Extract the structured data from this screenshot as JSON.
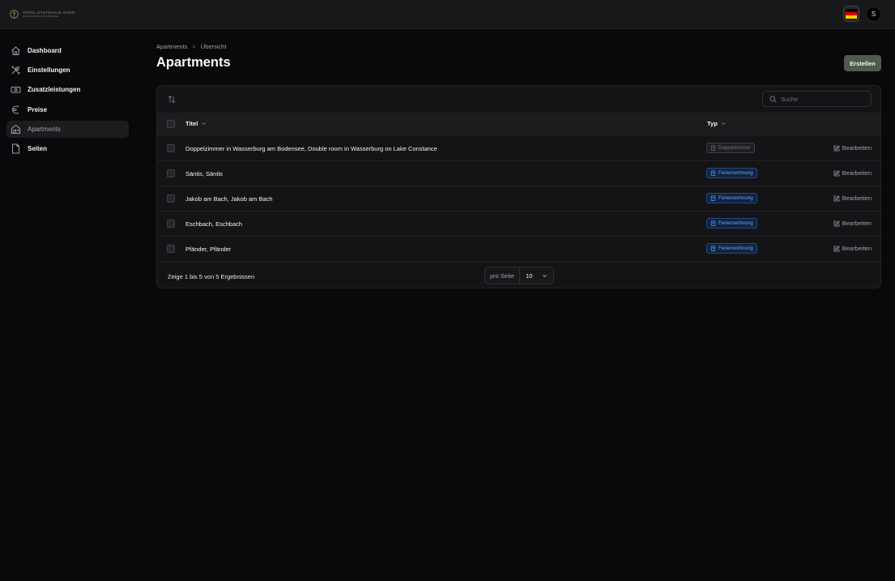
{
  "header": {
    "logo_text": "HOTEL GÄSTEHAUS STEIN",
    "logo_subtext": "WASSERBURG AM BODENSEE",
    "user_initial": "S",
    "flag_colors": [
      "#000000",
      "#dd0000",
      "#ffce00"
    ]
  },
  "sidebar": {
    "items": [
      {
        "label": "Dashboard",
        "icon": "home-icon",
        "active": false
      },
      {
        "label": "Einstellungen",
        "icon": "tools-icon",
        "active": false
      },
      {
        "label": "Zusatzleistungen",
        "icon": "cash-icon",
        "active": false
      },
      {
        "label": "Preise",
        "icon": "euro-icon",
        "active": false
      },
      {
        "label": "Apartments",
        "icon": "house-icon",
        "active": true
      },
      {
        "label": "Seiten",
        "icon": "document-icon",
        "active": false
      }
    ]
  },
  "breadcrumb": {
    "parent": "Apartments",
    "separator": ">",
    "current": "Übersicht"
  },
  "page": {
    "title": "Apartments",
    "create_label": "Erstellen"
  },
  "search": {
    "placeholder": "Suche"
  },
  "table": {
    "columns": {
      "title": "Titel",
      "type": "Typ"
    },
    "edit_label": "Bearbeiten",
    "rows": [
      {
        "title": "Doppelzimmer in Wasserburg am Bodensee, Double room in Wasserburg on Lake Constance",
        "type": "Doppelzimmer",
        "type_style": "gray"
      },
      {
        "title": "Säntis, Säntis",
        "type": "Ferienwohnung",
        "type_style": "blue"
      },
      {
        "title": "Jakob am Bach, Jakob am Bach",
        "type": "Ferienwohnung",
        "type_style": "blue"
      },
      {
        "title": "Eschbach, Eschbach",
        "type": "Ferienwohnung",
        "type_style": "blue"
      },
      {
        "title": "Pfänder, Pfänder",
        "type": "Ferienwohnung",
        "type_style": "blue"
      }
    ]
  },
  "footer": {
    "results_text": "Zeige 1 bis 5 von 5 Ergebnissen",
    "per_page_label": "pro Seite",
    "per_page_value": "10"
  },
  "colors": {
    "accent_button": "#4d5d4b",
    "badge_blue": "#60a5fa",
    "badge_gray": "#71717a"
  }
}
